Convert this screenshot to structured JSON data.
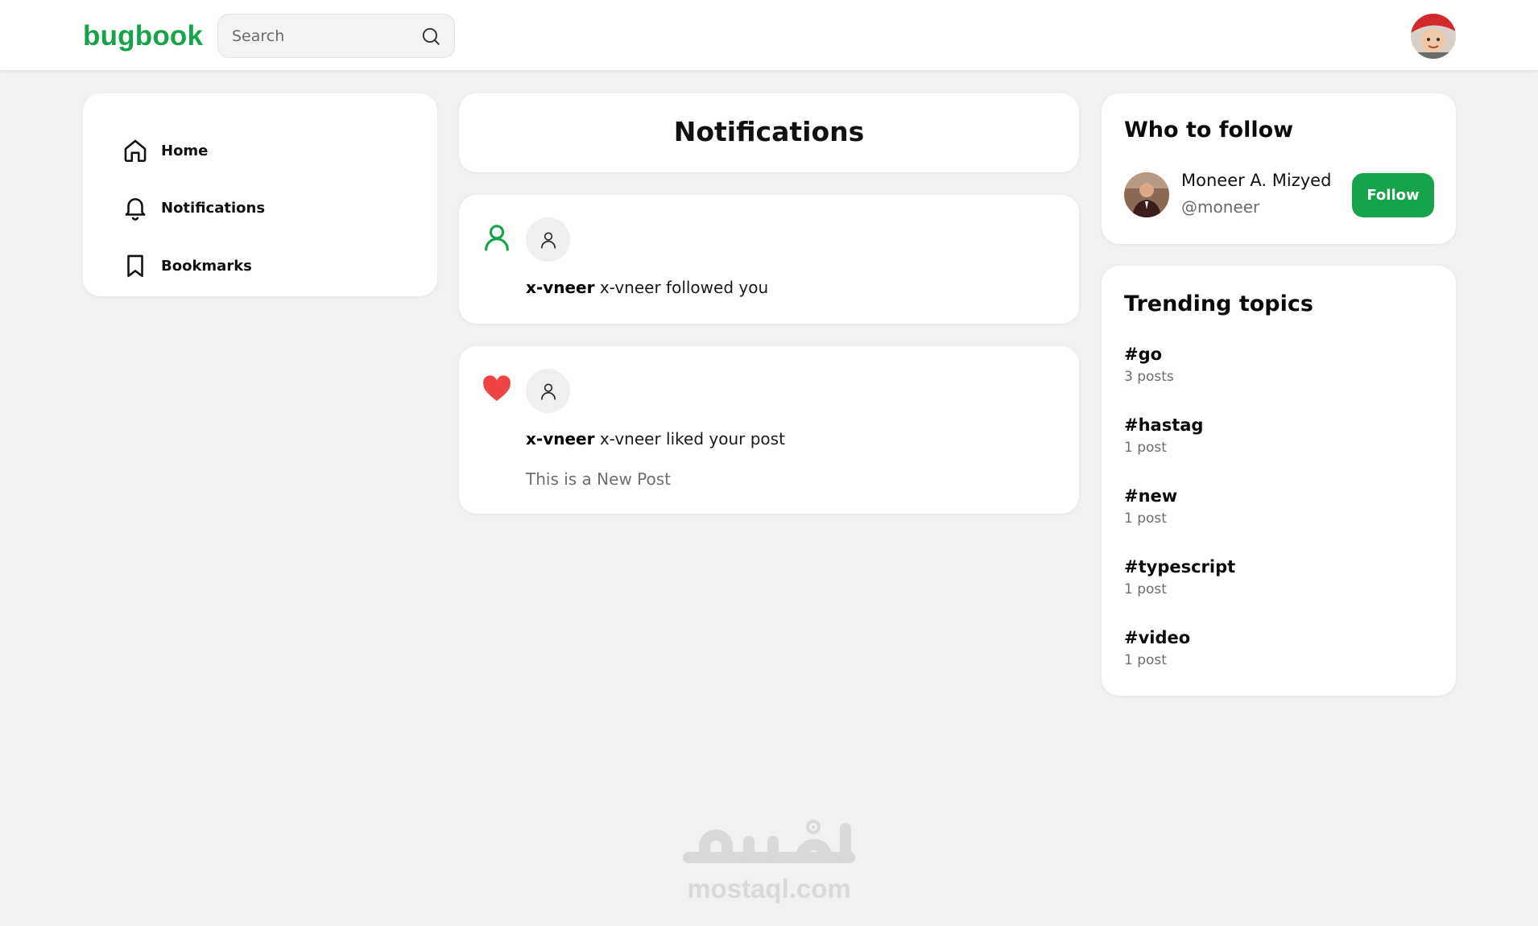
{
  "app": {
    "logo": "bugbook",
    "search": {
      "placeholder": "Search",
      "value": ""
    }
  },
  "colors": {
    "brand": "#16a34a",
    "like": "#ef4444",
    "background": "#f1f1f1"
  },
  "sidebar": {
    "items": [
      {
        "label": "Home",
        "icon": "home-icon"
      },
      {
        "label": "Notifications",
        "icon": "bell-icon"
      },
      {
        "label": "Bookmarks",
        "icon": "bookmark-icon"
      }
    ]
  },
  "main": {
    "title": "Notifications",
    "notifications": [
      {
        "type": "follow",
        "icon": "user-follow-icon",
        "user": "x-vneer",
        "text": "x-vneer followed you",
        "post": ""
      },
      {
        "type": "like",
        "icon": "heart-icon",
        "user": "x-vneer",
        "text": "x-vneer liked your post",
        "post": "This is a New Post"
      }
    ]
  },
  "who_to_follow": {
    "title": "Who to follow",
    "user": {
      "name": "Moneer A. Mizyed",
      "handle": "@moneer"
    },
    "button": "Follow"
  },
  "trending": {
    "title": "Trending topics",
    "topics": [
      {
        "tag": "#go",
        "count": "3 posts"
      },
      {
        "tag": "#hastag",
        "count": "1 post"
      },
      {
        "tag": "#new",
        "count": "1 post"
      },
      {
        "tag": "#typescript",
        "count": "1 post"
      },
      {
        "tag": "#video",
        "count": "1 post"
      }
    ]
  },
  "watermark": {
    "logo": "مستقل",
    "text": "mostaql.com"
  }
}
